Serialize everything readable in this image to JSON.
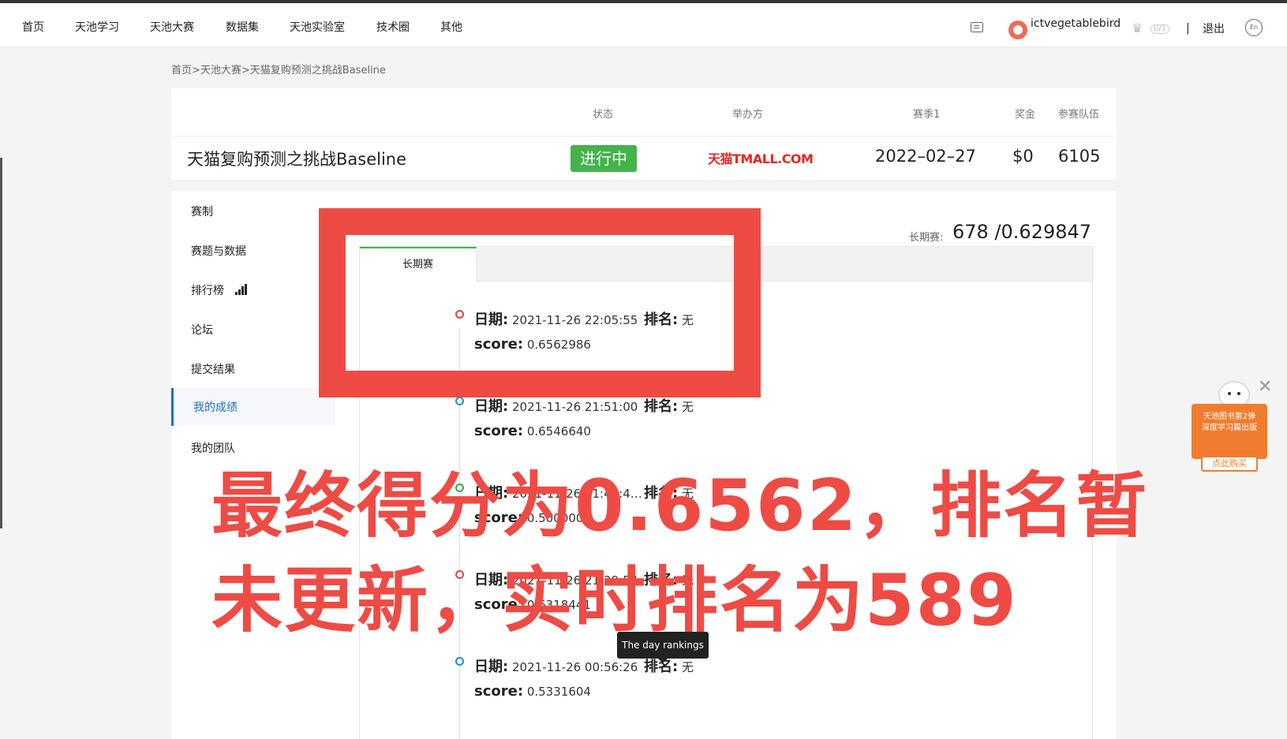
{
  "nav": {
    "items": [
      "首页",
      "天池学习",
      "天池大赛",
      "数据集",
      "天池实验室",
      "技术圈",
      "其他"
    ],
    "username": "ictvegetablebird",
    "level": "LV1",
    "divider": "|",
    "logout": "退出",
    "lang_toggle": "En"
  },
  "breadcrumb": "首页>天池大赛>天猫复购预测之挑战Baseline",
  "competition": {
    "title": "天猫复购预测之挑战Baseline",
    "labels": {
      "status": "状态",
      "organizer": "举办方",
      "season": "赛季1",
      "prize": "奖金",
      "teams": "参赛队伍"
    },
    "status": "进行中",
    "organizer_logo": "天猫TMALL.COM",
    "season_date": "2022–02–27",
    "prize": "$0",
    "teams": "6105"
  },
  "sidebar": {
    "items": [
      "赛制",
      "赛题与数据",
      "排行榜",
      "论坛",
      "提交结果",
      "我的成绩",
      "我的团队"
    ]
  },
  "scores": {
    "label": "长期赛:",
    "value": "678 /0.629847",
    "tab": "长期赛",
    "date_label": "日期:",
    "rank_label": "排名:",
    "score_label": "score:",
    "entries": [
      {
        "date": "2021-11-26 22:05:55",
        "rank": "无",
        "score": "0.6562986",
        "color": "#e5443f"
      },
      {
        "date": "2021-11-26 21:51:00",
        "rank": "无",
        "score": "0.6546640",
        "color": "#1d8fd6"
      },
      {
        "date": "2021-11-26 21:48:4…",
        "rank": "无",
        "score": "0.5000000",
        "color": "#33a852"
      },
      {
        "date": "2021-11-26 21:29:54",
        "rank": "无",
        "score": "0.6318441",
        "color": "#e5443f"
      },
      {
        "date": "2021-11-26 00:56:26",
        "rank": "无",
        "score": "0.5331604",
        "color": "#1d8fd6"
      }
    ]
  },
  "tooltip": "The day rankings",
  "overlay": {
    "line1": "最终得分为0.6562，排名暂",
    "line2": "未更新，实时排名为589"
  },
  "promo": {
    "line1": "天池图书第2弹",
    "line2": "深度学习篇出版",
    "button": "点此购买"
  }
}
